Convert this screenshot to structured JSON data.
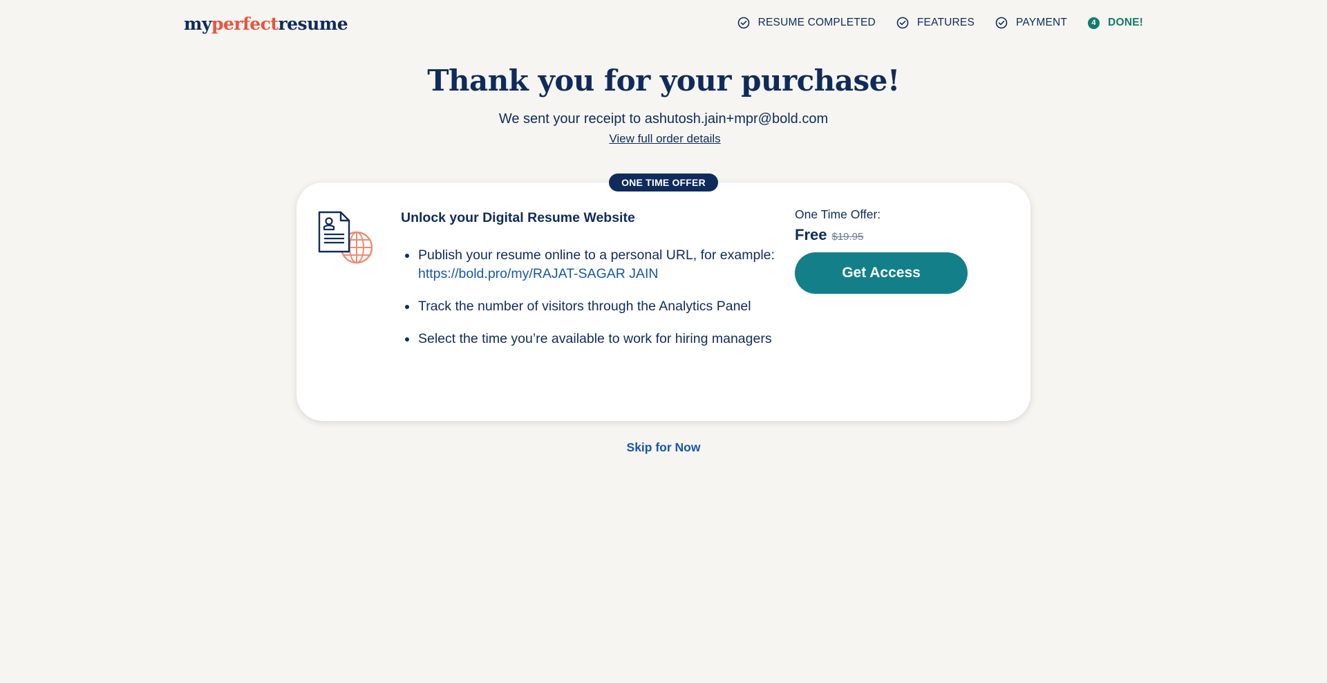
{
  "logo": {
    "part1": "my",
    "part2": "perfect",
    "part3": "resume"
  },
  "steps": [
    {
      "label": "RESUME COMPLETED",
      "icon": "check-circle-icon",
      "state": "completed"
    },
    {
      "label": "FEATURES",
      "icon": "check-circle-icon",
      "state": "completed"
    },
    {
      "label": "PAYMENT",
      "icon": "check-circle-icon",
      "state": "completed"
    },
    {
      "label": "DONE!",
      "number": "4",
      "state": "active"
    }
  ],
  "hero": {
    "title": "Thank you for your purchase!",
    "receipt_text": "We sent your receipt to ashutosh.jain+mpr@bold.com",
    "order_link": "View full order details"
  },
  "offer": {
    "badge": "ONE TIME OFFER",
    "icon": "resume-globe-icon",
    "title": "Unlock your Digital Resume Website",
    "features": [
      {
        "text": "Publish your resume online to a personal URL, for example:",
        "url": "https://bold.pro/my/RAJAT-SAGAR JAIN"
      },
      {
        "text": "Track the number of visitors through the Analytics Panel"
      },
      {
        "text": "Select the time you’re available to work for hiring managers"
      }
    ],
    "price_label": "One Time Offer:",
    "price": "Free",
    "original_price": "$19.95",
    "cta": "Get Access"
  },
  "skip_label": "Skip for Now",
  "colors": {
    "navy": "#0f2b5b",
    "accent_red": "#e8543f",
    "teal": "#127f89",
    "link_blue": "#1757a6",
    "background": "#f6f5f1"
  }
}
